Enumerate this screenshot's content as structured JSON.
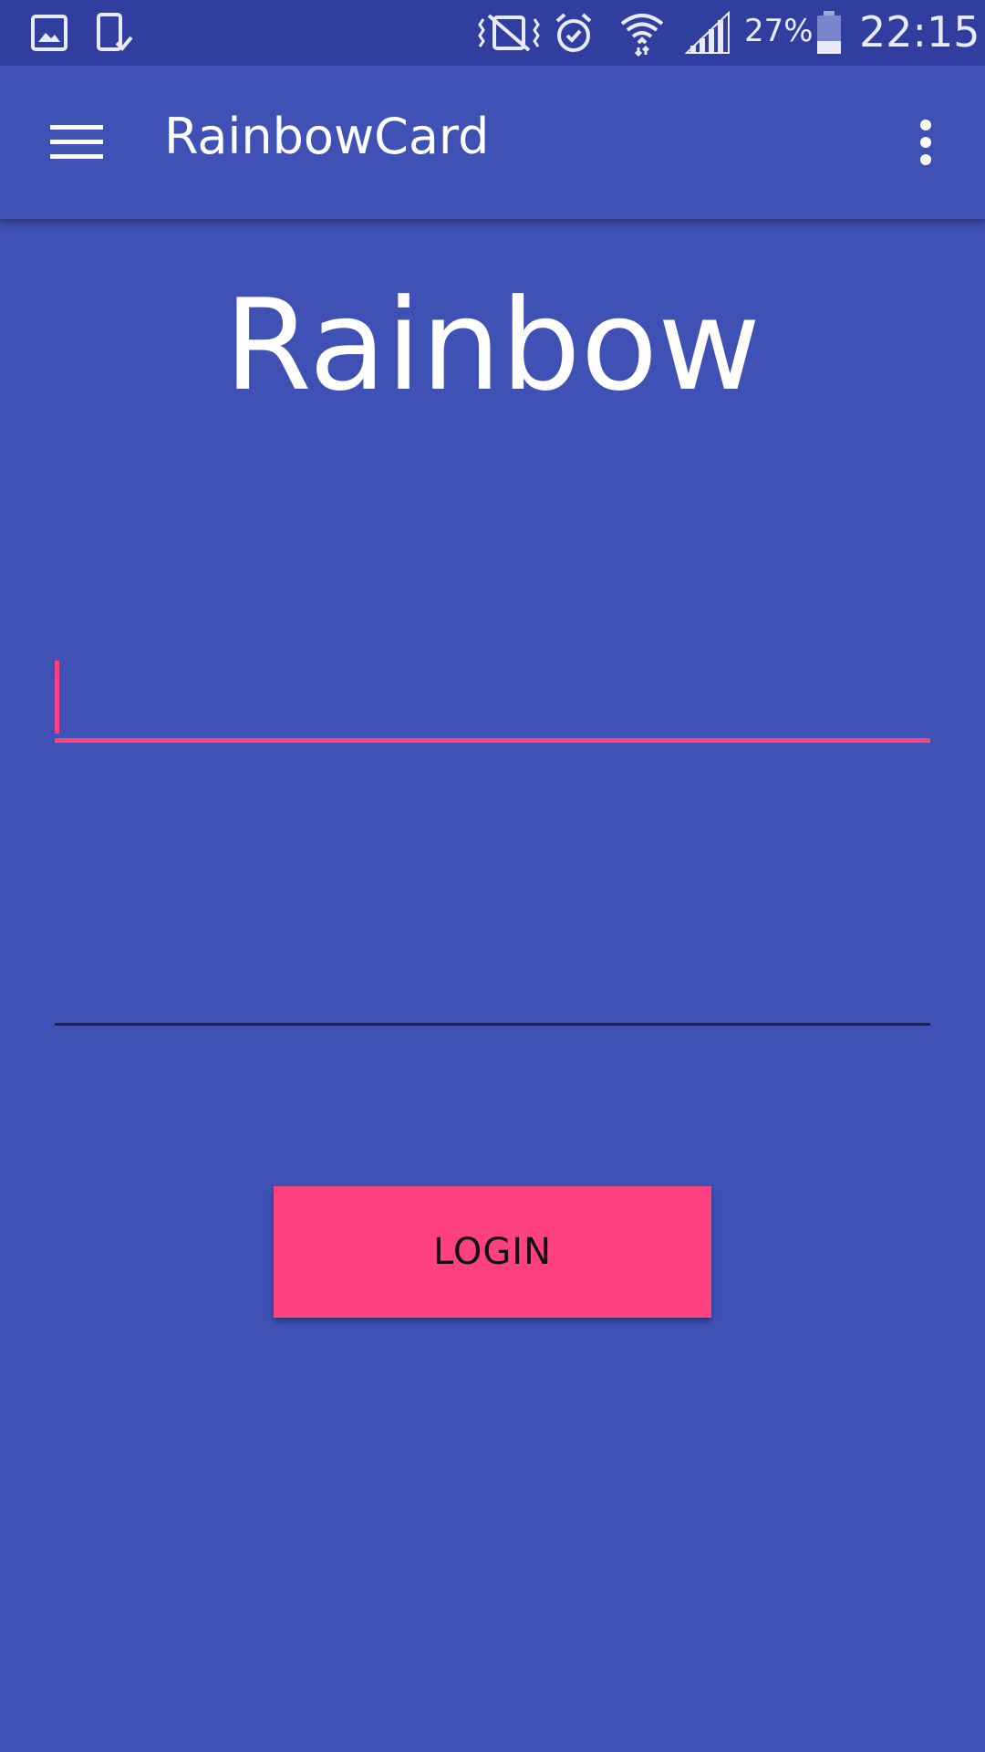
{
  "status_bar": {
    "left_icons": [
      "image-icon",
      "phone-check-icon"
    ],
    "right_icons": [
      "vibrate-off-icon",
      "alarm-icon",
      "wifi-icon",
      "signal-icon",
      "battery-icon"
    ],
    "battery_percent": "27%",
    "clock": "22:15"
  },
  "app_bar": {
    "menu_icon": "hamburger-menu-icon",
    "title": "RainbowCard",
    "overflow_icon": "more-vert-icon"
  },
  "main": {
    "logo_text": "Rainbow",
    "field_1": {
      "value": "",
      "placeholder": ""
    },
    "field_2": {
      "value": "",
      "placeholder": ""
    },
    "login_label": "LOGIN"
  },
  "colors": {
    "primary": "#3F51B5",
    "primary_dark": "#303F9F",
    "accent": "#FF4081"
  }
}
